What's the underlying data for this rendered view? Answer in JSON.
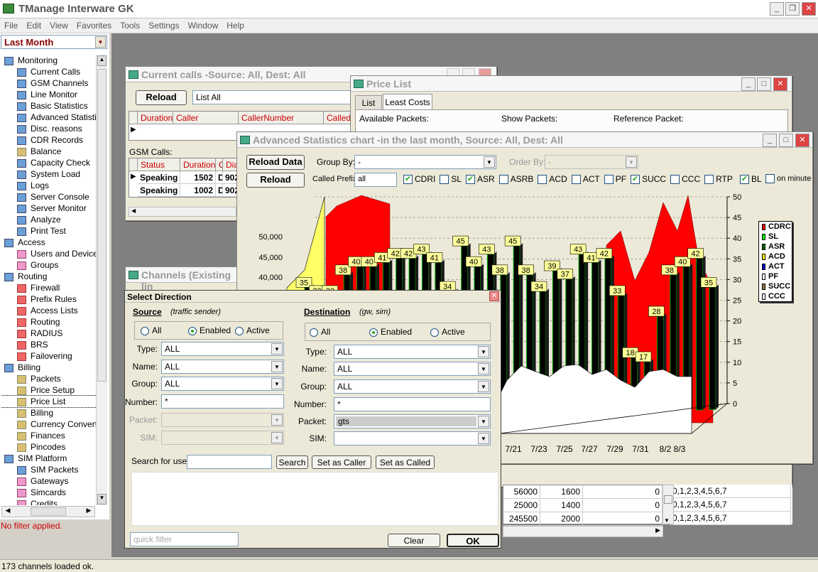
{
  "app": {
    "title": "TManage Interware GK"
  },
  "menu": [
    "File",
    "Edit",
    "View",
    "Favorites",
    "Tools",
    "Settings",
    "Window",
    "Help"
  ],
  "sidebar": {
    "period": "Last Month",
    "filter_status": "No filter applied.",
    "tree": [
      {
        "type": "grp",
        "label": "Monitoring",
        "icon": "monitor-icon"
      },
      {
        "type": "leaf",
        "label": "Current Calls",
        "icon": "grid-icon"
      },
      {
        "type": "leaf",
        "label": "GSM Channels",
        "icon": "grid-icon"
      },
      {
        "type": "leaf",
        "label": "Line Monitor",
        "icon": "grid-icon"
      },
      {
        "type": "leaf",
        "label": "Basic Statistics",
        "icon": "grid-icon"
      },
      {
        "type": "leaf",
        "label": "Advanced Statistic",
        "icon": "chart-icon"
      },
      {
        "type": "leaf",
        "label": "Disc. reasons",
        "icon": "chart-icon"
      },
      {
        "type": "leaf",
        "label": "CDR Records",
        "icon": "grid-icon"
      },
      {
        "type": "leaf",
        "label": "Balance",
        "icon": "database-icon"
      },
      {
        "type": "leaf",
        "label": "Capacity Check",
        "icon": "grid-icon"
      },
      {
        "type": "leaf",
        "label": "System Load",
        "icon": "grid-icon"
      },
      {
        "type": "leaf",
        "label": "Logs",
        "icon": "grid-icon"
      },
      {
        "type": "leaf",
        "label": "Server Console",
        "icon": "console-icon"
      },
      {
        "type": "leaf",
        "label": "Server Monitor",
        "icon": "console-icon"
      },
      {
        "type": "leaf",
        "label": "Analyze",
        "icon": "analyze-icon"
      },
      {
        "type": "leaf",
        "label": "Print Test",
        "icon": "print-icon"
      },
      {
        "type": "grp",
        "label": "Access",
        "icon": "access-icon"
      },
      {
        "type": "leaf",
        "label": "Users and Devices",
        "icon": "users-icon"
      },
      {
        "type": "leaf",
        "label": "Groups",
        "icon": "users-icon"
      },
      {
        "type": "grp",
        "label": "Routing",
        "icon": "routing-icon"
      },
      {
        "type": "leaf",
        "label": "Firewall",
        "icon": "firewall-icon"
      },
      {
        "type": "leaf",
        "label": "Prefix Rules",
        "icon": "firewall-icon"
      },
      {
        "type": "leaf",
        "label": "Access Lists",
        "icon": "firewall-icon"
      },
      {
        "type": "leaf",
        "label": "Routing",
        "icon": "firewall-icon"
      },
      {
        "type": "leaf",
        "label": "RADIUS",
        "icon": "firewall-icon"
      },
      {
        "type": "leaf",
        "label": "BRS",
        "icon": "firewall-icon"
      },
      {
        "type": "leaf",
        "label": "Failovering",
        "icon": "firewall-icon"
      },
      {
        "type": "grp",
        "label": "Billing",
        "icon": "billing-icon"
      },
      {
        "type": "leaf",
        "label": "Packets",
        "icon": "database-icon"
      },
      {
        "type": "leaf",
        "label": "Price Setup",
        "icon": "database-icon"
      },
      {
        "type": "leaf",
        "label": "Price List",
        "icon": "database-icon"
      },
      {
        "type": "leaf",
        "label": "Billing",
        "icon": "database-icon"
      },
      {
        "type": "leaf",
        "label": "Currency Converte",
        "icon": "database-icon"
      },
      {
        "type": "leaf",
        "label": "Finances",
        "icon": "database-icon"
      },
      {
        "type": "leaf",
        "label": "Pincodes",
        "icon": "database-icon"
      },
      {
        "type": "grp",
        "label": "SIM Platform",
        "icon": "sim-icon"
      },
      {
        "type": "leaf",
        "label": "SIM Packets",
        "icon": "grid-icon"
      },
      {
        "type": "leaf",
        "label": "Gateways",
        "icon": "users-icon"
      },
      {
        "type": "leaf",
        "label": "Simcards",
        "icon": "users-icon"
      },
      {
        "type": "leaf",
        "label": "Credits",
        "icon": "users-icon"
      }
    ]
  },
  "current_calls": {
    "title": "Current calls -Source: All, Dest: All",
    "reload": "Reload",
    "list_value": "List All",
    "headers": [
      "Duration",
      "Caller",
      "CallerNumber",
      "Called"
    ],
    "gsm_label": "GSM Calls:",
    "gsm_headers": [
      "Status",
      "Duration",
      "C",
      "Diale"
    ],
    "gsm_rows": [
      [
        "Speaking",
        "1502",
        "D",
        "902"
      ],
      [
        "Speaking",
        "1002",
        "D",
        "902"
      ]
    ]
  },
  "price_list": {
    "title": "Price List",
    "tabs": [
      "List",
      "Least Costs"
    ],
    "available": "Available Packets:",
    "show": "Show Packets:",
    "reference": "Reference Packet:",
    "rows": [
      [
        "56000",
        "1600",
        "0",
        "0,1,2,3,4,5,6,7"
      ],
      [
        "25000",
        "1400",
        "0",
        "0,1,2,3,4,5,6,7"
      ],
      [
        "245500",
        "2000",
        "0",
        "0,1,2,3,4,5,6,7"
      ]
    ]
  },
  "channels": {
    "title": "Channels (Existing lin"
  },
  "adv_chart": {
    "title": "Advanced Statistics chart -in the last month, Source: All, Dest: All",
    "reload_data": "Reload Data",
    "reload_chart": "Reload Chart",
    "group_by_label": "Group By:",
    "group_by_value": "-",
    "order_by_label": "Order By:",
    "order_by_value": "-",
    "prefix_label": "Called Prefix:",
    "prefix_value": "all",
    "checks": [
      {
        "label": "CDRI",
        "on": true
      },
      {
        "label": "SL",
        "on": false
      },
      {
        "label": "ASR",
        "on": true
      },
      {
        "label": "ASRB",
        "on": false
      },
      {
        "label": "ACD",
        "on": false
      },
      {
        "label": "ACT",
        "on": false
      },
      {
        "label": "PF",
        "on": false
      },
      {
        "label": "SUCC",
        "on": true
      },
      {
        "label": "CCC",
        "on": false
      },
      {
        "label": "RTP",
        "on": false
      }
    ],
    "bl_label": "BL",
    "on_minute_label": "on minute"
  },
  "chart_data": {
    "type": "bar",
    "left_axis_ticks": [
      "50,000",
      "45,000",
      "40,000"
    ],
    "right_axis_ticks": [
      "50",
      "45",
      "40",
      "35",
      "30",
      "25",
      "20",
      "15",
      "10",
      "5",
      "0"
    ],
    "right_ylim": [
      0,
      50
    ],
    "x_tick_labels": [
      "7/21",
      "7/23",
      "7/25",
      "7/27",
      "7/29",
      "7/31",
      "8/2",
      "8/3"
    ],
    "asr_labels": [
      "35",
      "33",
      "33",
      "38",
      "40",
      "40",
      "41",
      "42",
      "42",
      "43",
      "41",
      "34",
      "45",
      "40",
      "43",
      "38",
      "45",
      "38",
      "34",
      "39",
      "37",
      "43",
      "41",
      "42",
      "33",
      "18",
      "17",
      "28",
      "38",
      "40",
      "42",
      "35"
    ],
    "legend": [
      {
        "name": "CDRC",
        "color": "#ff0000"
      },
      {
        "name": "SL",
        "color": "#00ff00"
      },
      {
        "name": "ASR",
        "color": "#006600"
      },
      {
        "name": "ACD",
        "color": "#ffff00"
      },
      {
        "name": "ACT",
        "color": "#0000cc"
      },
      {
        "name": "PF",
        "color": "#ffffff"
      },
      {
        "name": "SUCC",
        "color": "#887744"
      },
      {
        "name": "CCC",
        "color": "#ffffff"
      }
    ]
  },
  "select_direction": {
    "title": "Select Direction",
    "source_label": "Source",
    "source_hint": "(traffic sender)",
    "dest_label": "Destination",
    "dest_hint": "(gw, sim)",
    "radio_all": "All",
    "radio_enabled": "Enabled",
    "radio_active": "Active",
    "type_label": "Type:",
    "name_label": "Name:",
    "group_label": "Group:",
    "number_label": "Number:",
    "packet_label": "Packet:",
    "sim_label": "SIM:",
    "src_type": "ALL",
    "src_name": "ALL",
    "src_group": "ALL",
    "src_number": "*",
    "dst_type": "ALL",
    "dst_name": "ALL",
    "dst_group": "ALL",
    "dst_number": "*",
    "dst_packet": "gts",
    "search_label": "Search for user:",
    "search_btn": "Search",
    "set_caller": "Set as Caller",
    "set_called": "Set as Called",
    "quick_filter_placeholder": "quick filter",
    "clear": "Clear",
    "ok": "OK"
  },
  "status": {
    "text": "173 channels loaded ok."
  }
}
